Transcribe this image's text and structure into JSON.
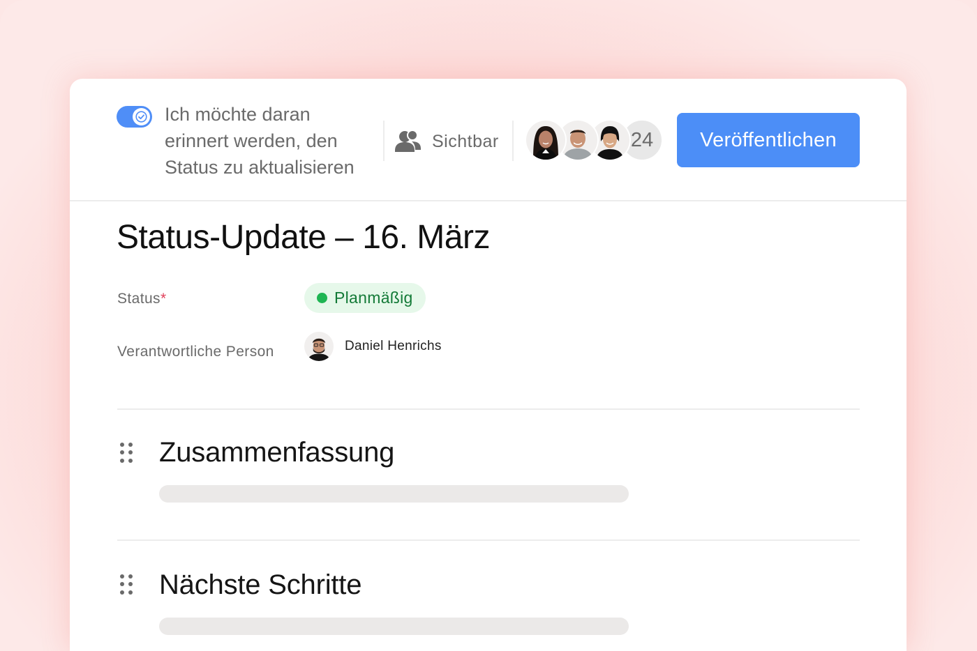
{
  "colors": {
    "accent": "#4c8ef7",
    "status_green": "#1fb553",
    "status_bg": "#e6f8ea",
    "required": "#e0405a",
    "background": "#fde7e6"
  },
  "header": {
    "reminder_toggle": {
      "on": true,
      "icon": "check-icon"
    },
    "reminder_text": "Ich möchte daran erinnert werden, den Status zu aktualisieren",
    "visibility": {
      "icon": "people-icon",
      "label": "Sichtbar"
    },
    "members": {
      "avatars": [
        "avatar-woman-1",
        "avatar-man-1",
        "avatar-woman-2"
      ],
      "count": "24"
    },
    "publish_label": "Veröffentlichen"
  },
  "page": {
    "title": "Status-Update – 16. März",
    "fields": {
      "status_label": "Status",
      "required_mark": "*",
      "status_value": "Planmäßig",
      "owner_label": "Verantwortliche Person",
      "owner_name": "Daniel Henrichs"
    },
    "sections": [
      {
        "title": "Zusammenfassung",
        "icon": "drag-handle-icon"
      },
      {
        "title": "Nächste Schritte",
        "icon": "drag-handle-icon"
      }
    ]
  }
}
